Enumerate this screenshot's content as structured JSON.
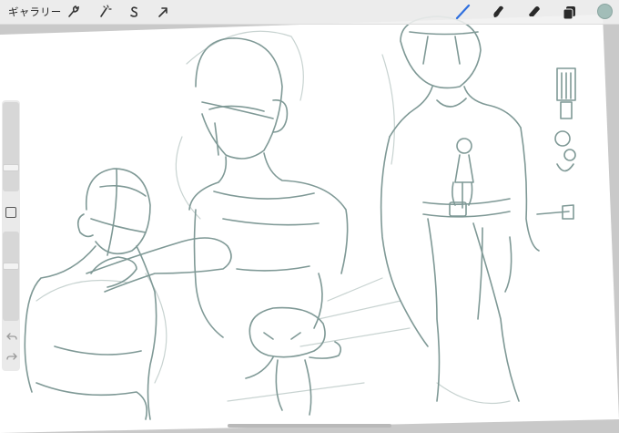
{
  "app": {
    "gallery_label": "ギャラリー",
    "accent_color": "#2f6fde",
    "sketch_color": "#7f9996",
    "current_color": "#a2bdb8"
  },
  "toolbar": {
    "left_tools": [
      {
        "name": "actions",
        "icon": "wrench-icon"
      },
      {
        "name": "adjustments",
        "icon": "magic-wand-icon"
      },
      {
        "name": "selection",
        "icon": "selection-s-icon"
      },
      {
        "name": "transform",
        "icon": "arrow-cursor-icon"
      }
    ],
    "right_tools": [
      {
        "name": "brush",
        "icon": "brush-icon",
        "active": true
      },
      {
        "name": "smudge",
        "icon": "smudge-icon",
        "active": false
      },
      {
        "name": "eraser",
        "icon": "eraser-icon",
        "active": false
      },
      {
        "name": "layers",
        "icon": "layers-icon",
        "active": false
      },
      {
        "name": "colors",
        "icon": "color-swatch",
        "active": false
      }
    ]
  },
  "sidebar": {
    "brush_size_level": 0.7,
    "opacity_level": 0.6
  }
}
